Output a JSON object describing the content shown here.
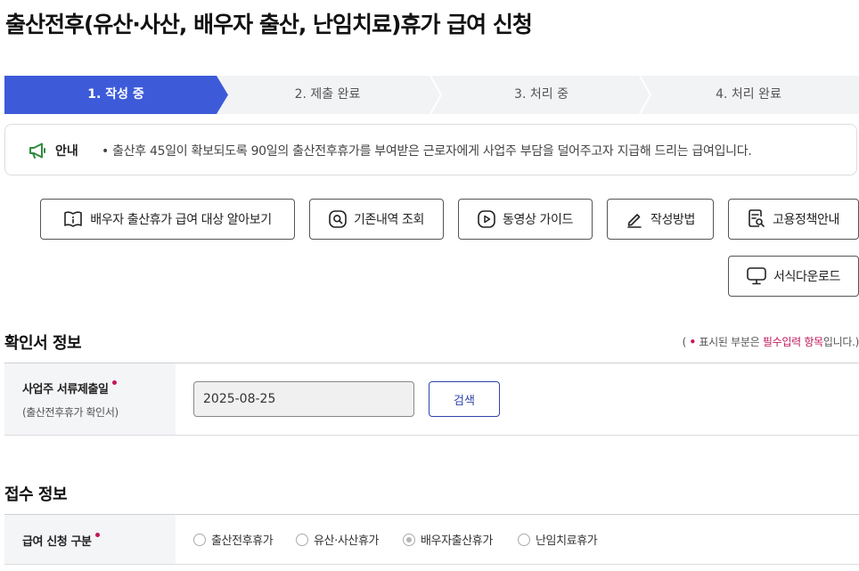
{
  "page_title": "출산전후(유산·사산, 배우자 출산, 난임치료)휴가 급여 신청",
  "steps": [
    {
      "label": "1. 작성 중",
      "active": true
    },
    {
      "label": "2. 제출 완료",
      "active": false
    },
    {
      "label": "3. 처리 중",
      "active": false
    },
    {
      "label": "4. 처리 완료",
      "active": false
    }
  ],
  "notice": {
    "icon": "megaphone-icon",
    "label": "안내",
    "text": "• 출산후 45일이 확보되도록 90일의 출산전후휴가를 부여받은 근로자에게 사업주 부담을 덜어주고자 지급해 드리는 급여입니다."
  },
  "buttons": [
    {
      "label": "배우자 출산휴가 급여 대상 알아보기",
      "icon": "book-info-icon"
    },
    {
      "label": "기존내역 조회",
      "icon": "search-icon"
    },
    {
      "label": "동영상 가이드",
      "icon": "video-play-icon"
    },
    {
      "label": "작성방법",
      "icon": "pen-icon"
    },
    {
      "label": "고용정책안내",
      "icon": "document-search-icon"
    },
    {
      "label": "서식다운로드",
      "icon": "monitor-icon"
    }
  ],
  "section_confirm": {
    "title": "확인서 정보",
    "req_note_prefix": "(",
    "req_note_mid": "표시된 부분은",
    "req_note_highlight": "필수입력 항목",
    "req_note_suffix": "입니다.)",
    "field_label": "사업주 서류제출일",
    "field_sub": "(출산전후휴가 확인서)",
    "date_value": "2025-08-25",
    "search_label": "검색"
  },
  "section_receipt": {
    "title": "접수 정보",
    "field_label": "급여 신청 구분",
    "options": [
      {
        "label": "출산전후휴가",
        "checked": false
      },
      {
        "label": "유산·사산휴가",
        "checked": false
      },
      {
        "label": "배우자출산휴가",
        "checked": true
      },
      {
        "label": "난임치료휴가",
        "checked": false
      }
    ]
  },
  "colors": {
    "accent": "#3d5bd9",
    "required": "#c2185b",
    "search_button": "#2f45a8"
  }
}
